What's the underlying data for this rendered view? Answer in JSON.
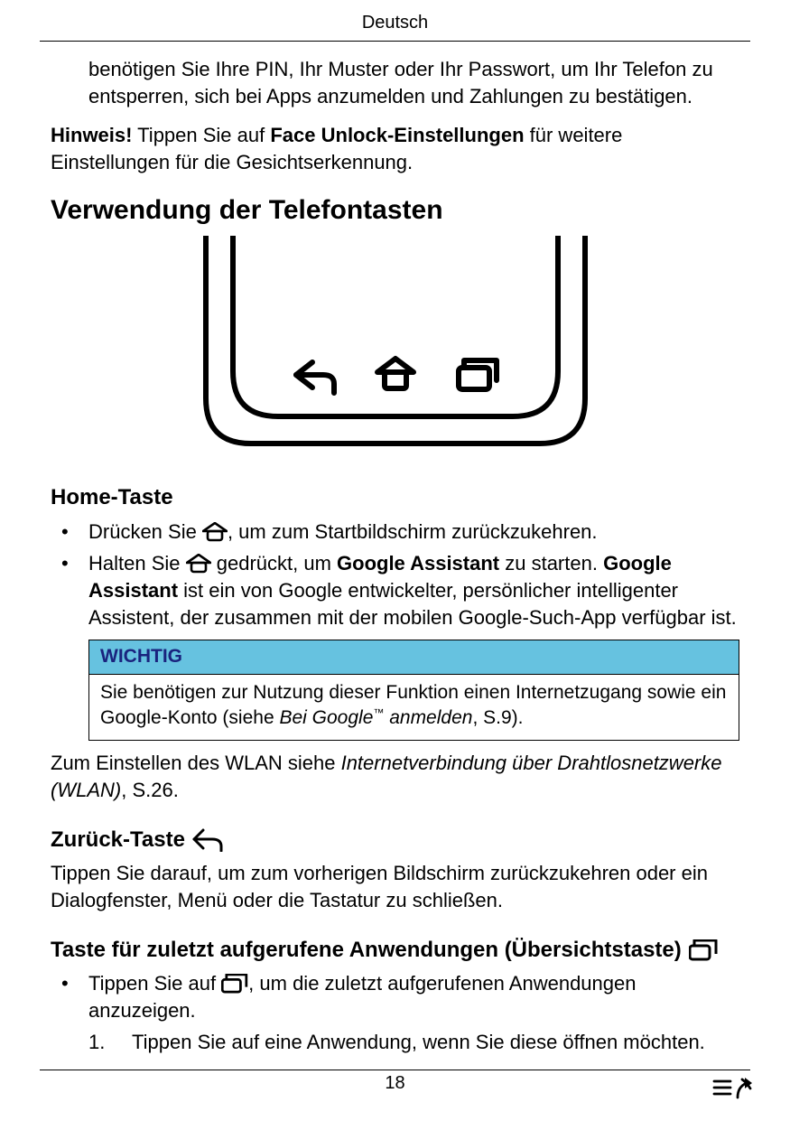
{
  "header": {
    "language": "Deutsch"
  },
  "intro_continuation": "benötigen Sie Ihre PIN, Ihr Muster oder Ihr Passwort, um Ihr Telefon zu entsperren, sich bei Apps anzumelden und Zahlungen zu bestätigen.",
  "note": {
    "prefix": "Hinweis!",
    "before_bold": " Tippen Sie auf ",
    "bold_phrase": "Face Unlock-Einstellungen",
    "after_bold": " für weitere Einstellungen für die Gesichtserkennung."
  },
  "section_heading": "Verwendung der Telefontasten",
  "home": {
    "heading": "Home-Taste",
    "bullet1_pre": "Drücken Sie ",
    "bullet1_post": ", um zum Startbildschirm zurückzukehren.",
    "bullet2_pre": "Halten Sie ",
    "bullet2_mid1": " gedrückt, um ",
    "bullet2_bold1": "Google Assistant",
    "bullet2_mid2": " zu starten. ",
    "bullet2_bold2": "Google Assistant",
    "bullet2_post": " ist ein von Google entwickelter, persönlicher intelligenter Assistent, der zusammen mit der mobilen Google-Such-App verfügbar ist."
  },
  "important": {
    "title": "WICHTIG",
    "line1": "Sie benötigen zur Nutzung dieser Funktion einen Internetzugang sowie ein Google-Konto (siehe ",
    "ref_italic": "Bei Google",
    "tm": "™",
    "ref_italic2": " anmelden",
    "page_ref": ", S.9)."
  },
  "wlan_para_pre": "Zum Einstellen des WLAN siehe ",
  "wlan_para_italic": "Internetverbindung über Drahtlosnetzwerke (WLAN)",
  "wlan_para_post": ", S.26.",
  "back": {
    "heading": "Zurück-Taste",
    "body": "Tippen Sie darauf, um zum vorherigen Bildschirm zurückzukehren oder ein Dialogfenster, Menü oder die Tastatur zu schließen."
  },
  "recent": {
    "heading": "Taste für zuletzt aufgerufene Anwendungen (Übersichtstaste)",
    "bullet_pre": "Tippen Sie auf ",
    "bullet_post": ", um die zuletzt aufgerufenen Anwendungen anzuzeigen.",
    "step1_num": "1.",
    "step1_text": "Tippen Sie auf eine Anwendung, wenn Sie diese öffnen möchten."
  },
  "footer": {
    "page_number": "18"
  }
}
